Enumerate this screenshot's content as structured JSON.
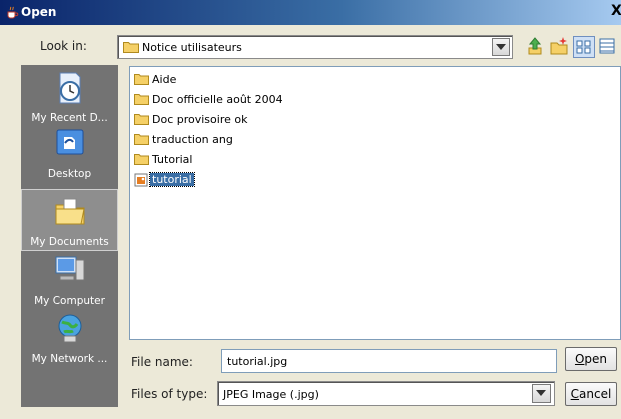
{
  "window": {
    "title": "Open",
    "close_glyph": "X"
  },
  "lookin": {
    "label": "Look in:",
    "value": "Notice utilisateurs",
    "icon": "folder-icon"
  },
  "toolbar": {
    "icons": [
      "up-folder-icon",
      "new-folder-icon",
      "list-view-icon",
      "details-view-icon"
    ]
  },
  "places": [
    {
      "label": "My Recent D...",
      "icon": "recent-documents-icon",
      "selected": false
    },
    {
      "label": "Desktop",
      "icon": "desktop-icon",
      "selected": false
    },
    {
      "label": "My Documents",
      "icon": "my-documents-icon",
      "selected": true
    },
    {
      "label": "My Computer",
      "icon": "my-computer-icon",
      "selected": false
    },
    {
      "label": "My Network ...",
      "icon": "network-icon",
      "selected": false
    }
  ],
  "files": [
    {
      "name": "Aide",
      "type": "folder"
    },
    {
      "name": "Doc officielle août 2004",
      "type": "folder"
    },
    {
      "name": "Doc provisoire ok",
      "type": "folder"
    },
    {
      "name": "traduction ang",
      "type": "folder"
    },
    {
      "name": "Tutorial",
      "type": "folder"
    },
    {
      "name": "tutorial",
      "type": "image",
      "selected": true
    }
  ],
  "filename": {
    "label": "File name:",
    "value": "tutorial.jpg"
  },
  "filetype": {
    "label": "Files of type:",
    "value": "JPEG Image (.jpg)"
  },
  "buttons": {
    "open_mnemonic": "O",
    "open_rest": "pen",
    "cancel_mnemonic": "C",
    "cancel_rest": "ancel"
  },
  "colors": {
    "titlebar_start": "#0a246a",
    "places_bg": "#737373",
    "selection": "#3a6ea5"
  }
}
